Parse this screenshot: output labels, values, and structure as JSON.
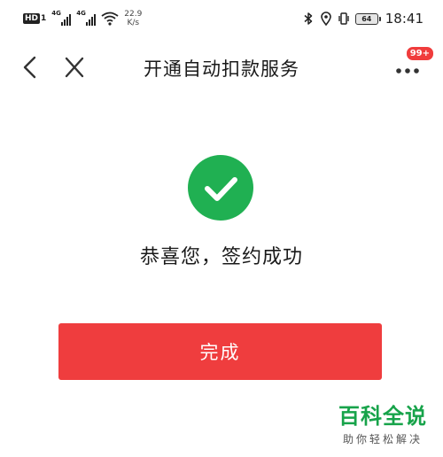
{
  "status_bar": {
    "hd_label": "HD",
    "hd_sub": "1",
    "signal_1_label": "4G",
    "signal_2_label": "4G",
    "net_speed_value": "22.9",
    "net_speed_unit": "K/s",
    "battery_level": "64",
    "time": "18:41",
    "icons": [
      "bluetooth-icon",
      "location-icon",
      "vibrate-icon",
      "battery-icon"
    ]
  },
  "nav": {
    "title": "开通自动扣款服务",
    "more_badge": "99+",
    "icons": [
      "back-arrow-icon",
      "close-icon",
      "more-dots-icon"
    ]
  },
  "result": {
    "icon": "checkmark-circle-icon",
    "icon_color": "#20b052",
    "message": "恭喜您，签约成功"
  },
  "actions": {
    "done_label": "完成",
    "done_color": "#ef3d3e"
  },
  "watermark": {
    "brand": "百科全说",
    "slogan": "助你轻松解决",
    "color": "#17a34a"
  }
}
